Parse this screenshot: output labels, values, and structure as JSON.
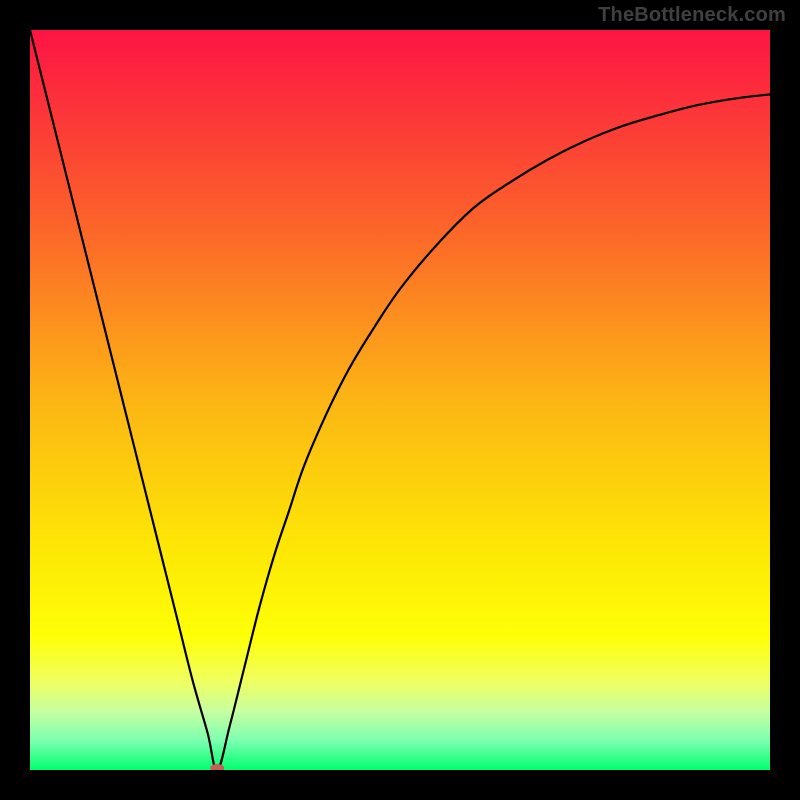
{
  "watermark": "TheBottleneck.com",
  "chart_data": {
    "type": "line",
    "title": "",
    "xlabel": "",
    "ylabel": "",
    "xlim": [
      0,
      100
    ],
    "ylim": [
      0,
      100
    ],
    "grid": false,
    "legend": false,
    "annotations": {
      "marker_x": 25.3,
      "marker_y": 0
    },
    "series": [
      {
        "name": "bottleneck-curve",
        "x": [
          0,
          2,
          4,
          6,
          8,
          10,
          12,
          14,
          16,
          18,
          20,
          22,
          24,
          25.3,
          27,
          29,
          31,
          33,
          35,
          37,
          40,
          43,
          46,
          50,
          55,
          60,
          65,
          70,
          75,
          80,
          85,
          90,
          95,
          100
        ],
        "values": [
          100,
          92,
          84,
          76,
          68,
          60,
          52,
          44,
          36,
          28,
          20,
          12,
          5,
          0,
          6,
          14,
          22,
          29,
          35,
          41,
          48,
          54,
          59,
          65,
          71,
          76,
          79.5,
          82.5,
          85,
          87,
          88.5,
          89.8,
          90.7,
          91.3
        ]
      }
    ],
    "background_gradient_stops": [
      {
        "pct": 0,
        "color": "#fd1444"
      },
      {
        "pct": 25,
        "color": "#fc5f2b"
      },
      {
        "pct": 50,
        "color": "#fcb514"
      },
      {
        "pct": 70,
        "color": "#fde705"
      },
      {
        "pct": 82,
        "color": "#feff06"
      },
      {
        "pct": 88,
        "color": "#f0ff61"
      },
      {
        "pct": 92,
        "color": "#c8ffa0"
      },
      {
        "pct": 96,
        "color": "#7dffb0"
      },
      {
        "pct": 100,
        "color": "#00ff70"
      }
    ],
    "marker": {
      "color": "#c16058",
      "rx": 7,
      "ry": 4
    }
  }
}
